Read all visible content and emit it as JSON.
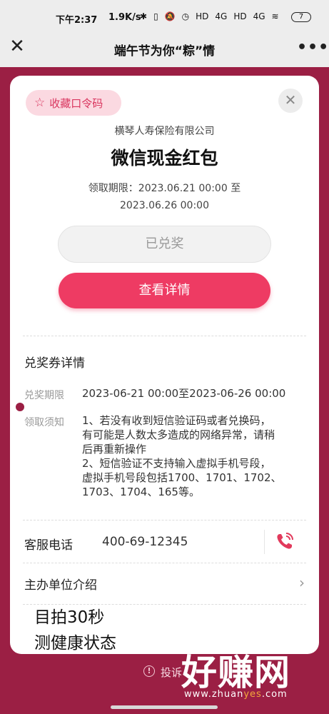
{
  "status_bar": {
    "time": "下午2:37",
    "speed": "1.9K/s",
    "icons": [
      "bluetooth-icon",
      "vibrate-icon",
      "mute-icon",
      "alarm-icon",
      "hd-icon",
      "signal-4g-icon",
      "hd-icon",
      "signal-4g-icon",
      "wifi-icon"
    ],
    "icon_glyphs": [
      "✱",
      "▯",
      "🔕",
      "◷",
      "HD",
      "4G",
      "HD",
      "4G",
      "≋"
    ],
    "battery": "7"
  },
  "nav": {
    "close_icon": "close-icon",
    "title": "端午节为你“粽”情",
    "more_icon": "more-dots-icon",
    "more_glyph": "•••"
  },
  "card": {
    "favorite_label": "收藏口令码",
    "company": "横琴人寿保险有限公司",
    "prize_title": "微信现金红包",
    "period_line1": "领取期限：2023.06.21 00:00 至",
    "period_line2": "2023.06.26 00:00",
    "redeemed_label": "已兑奖",
    "detail_button": "查看详情"
  },
  "details": {
    "section_title": "兑奖券详情",
    "redeem_period_label": "兑奖期限",
    "redeem_period_value": "2023-06-21 00:00至2023-06-26 00:00",
    "notice_label": "领取须知",
    "notice_lines": [
      "1、若没有收到短信验证码或者兑换码，",
      "有可能是人数太多造成的网络异常，请稍",
      "后再重新操作",
      "2、短信验证不支持输入虚拟手机号段，",
      "虚拟手机号段包括1700、1701、1702、",
      "1703、1704、165等。"
    ],
    "phone_label": "客服电话",
    "phone_value": "400-69-12345",
    "organizer_label": "主办单位介绍"
  },
  "ad": {
    "line1": "目拍30秒",
    "line2": "测健康状态"
  },
  "footer": {
    "report_label": "投诉"
  },
  "watermark": {
    "main": "好赚网",
    "url_prefix": "www.zhuan",
    "url_highlight": "yes",
    "url_suffix": ".com"
  },
  "colors": {
    "background": "#9b1f44",
    "accent": "#ee3b63",
    "badge_bg": "#fbd9e1"
  }
}
